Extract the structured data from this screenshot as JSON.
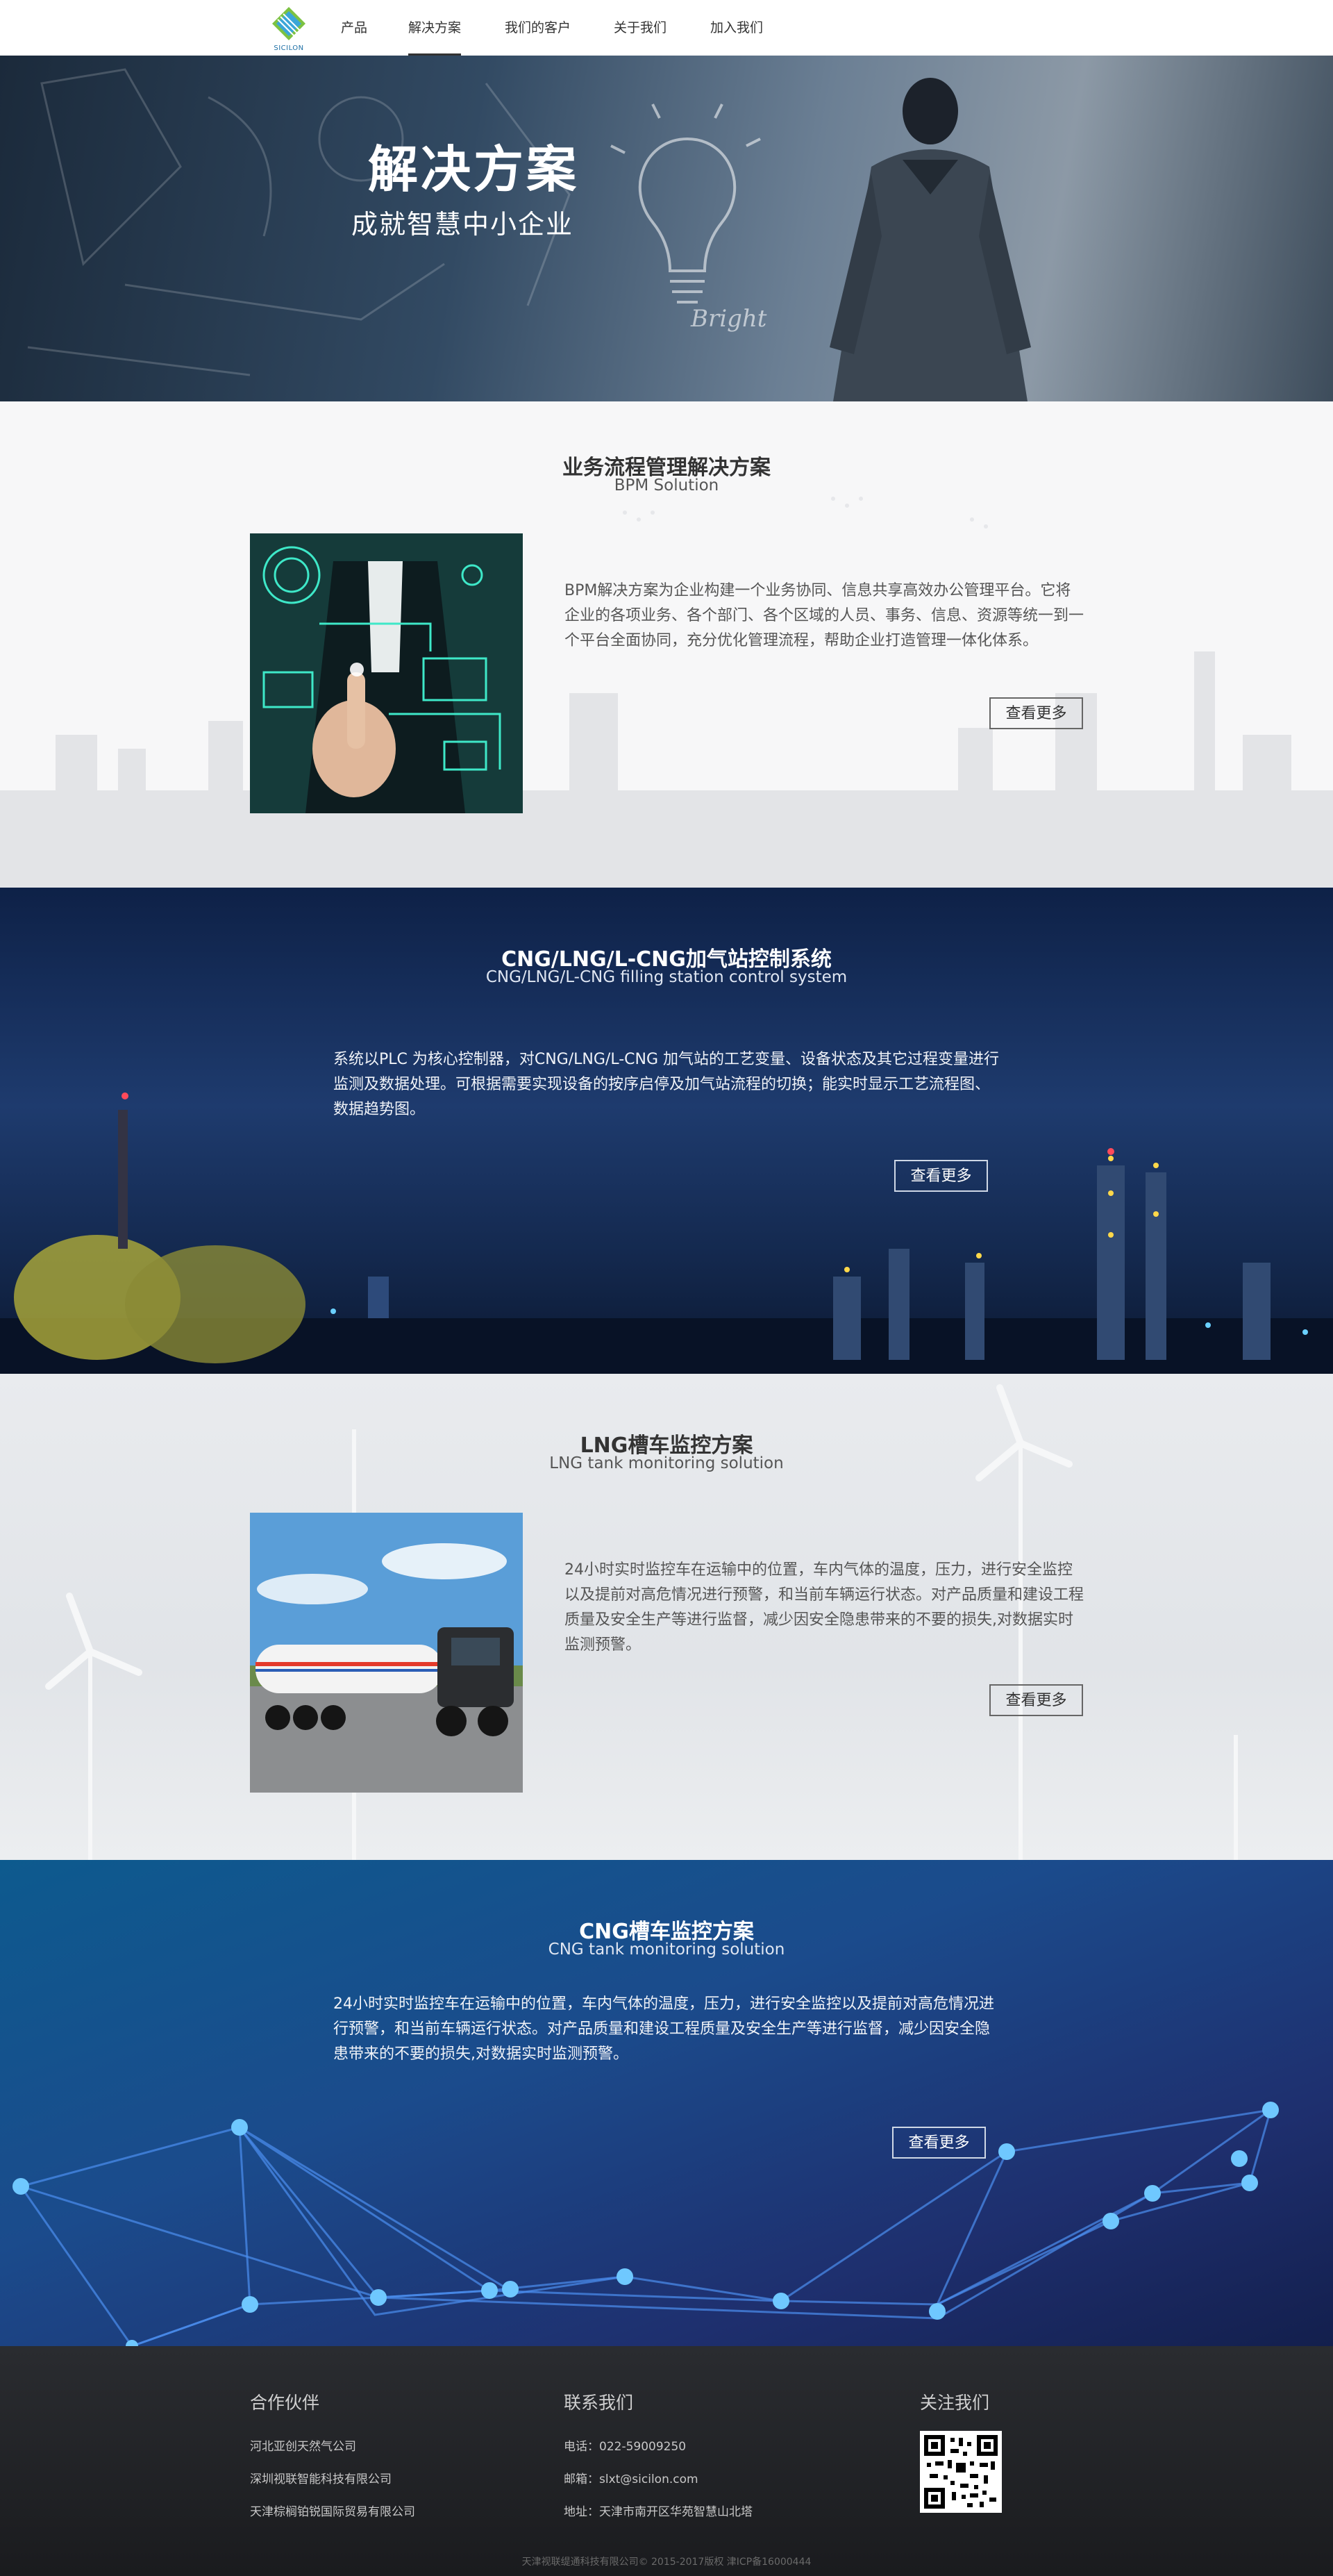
{
  "nav": {
    "logo_text": "SICILON",
    "items": [
      {
        "label": "产品",
        "active": false
      },
      {
        "label": "解决方案",
        "active": true
      },
      {
        "label": "我们的客户",
        "active": false
      },
      {
        "label": "关于我们",
        "active": false
      },
      {
        "label": "加入我们",
        "active": false
      }
    ]
  },
  "hero": {
    "title": "解决方案",
    "subtitle": "成就智慧中小企业",
    "sketch_text": "Bright"
  },
  "sections": [
    {
      "title": "业务流程管理解决方案",
      "subtitle": "BPM Solution",
      "body": "BPM解决方案为企业构建一个业务协同、信息共享高效办公管理平台。它将企业的各项业务、各个部门、各个区域的人员、事务、信息、资源等统一到一个平台全面协同，充分优化管理流程，帮助企业打造管理一体化体系。",
      "button": "查看更多"
    },
    {
      "title": "CNG/LNG/L-CNG加气站控制系统",
      "subtitle": "CNG/LNG/L-CNG filling station control system",
      "body": "系统以PLC 为核心控制器，对CNG/LNG/L-CNG 加气站的工艺变量、设备状态及其它过程变量进行监测及数据处理。可根据需要实现设备的按序启停及加气站流程的切换；能实时显示工艺流程图、数据趋势图。",
      "button": "查看更多"
    },
    {
      "title": "LNG槽车监控方案",
      "subtitle": "LNG tank monitoring solution",
      "body": "24小时实时监控车在运输中的位置，车内气体的温度，压力，进行安全监控以及提前对高危情况进行预警，和当前车辆运行状态。对产品质量和建设工程质量及安全生产等进行监督，减少因安全隐患带来的不要的损失,对数据实时监测预警。",
      "button": "查看更多"
    },
    {
      "title": "CNG槽车监控方案",
      "subtitle": "CNG tank monitoring solution",
      "body": "24小时实时监控车在运输中的位置，车内气体的温度，压力，进行安全监控以及提前对高危情况进行预警，和当前车辆运行状态。对产品质量和建设工程质量及安全生产等进行监督，减少因安全隐患带来的不要的损失,对数据实时监测预警。",
      "button": "查看更多"
    }
  ],
  "footer": {
    "partners": {
      "heading": "合作伙伴",
      "items": [
        "河北亚创天然气公司",
        "深圳视联智能科技有限公司",
        "天津棕榈铂锐国际贸易有限公司"
      ]
    },
    "contact": {
      "heading": "联系我们",
      "items": [
        "电话：022-59009250",
        "邮箱：slxt@sicilon.com",
        "地址：天津市南开区华苑智慧山北塔"
      ]
    },
    "follow": {
      "heading": "关注我们"
    },
    "copyright": "天津视联缇通科技有限公司© 2015-2017版权 津ICP备16000444"
  },
  "colors": {
    "nav_active": "#333333",
    "footer_bg": "#1f2023",
    "dark_blue_section": "#1e3b6e"
  }
}
